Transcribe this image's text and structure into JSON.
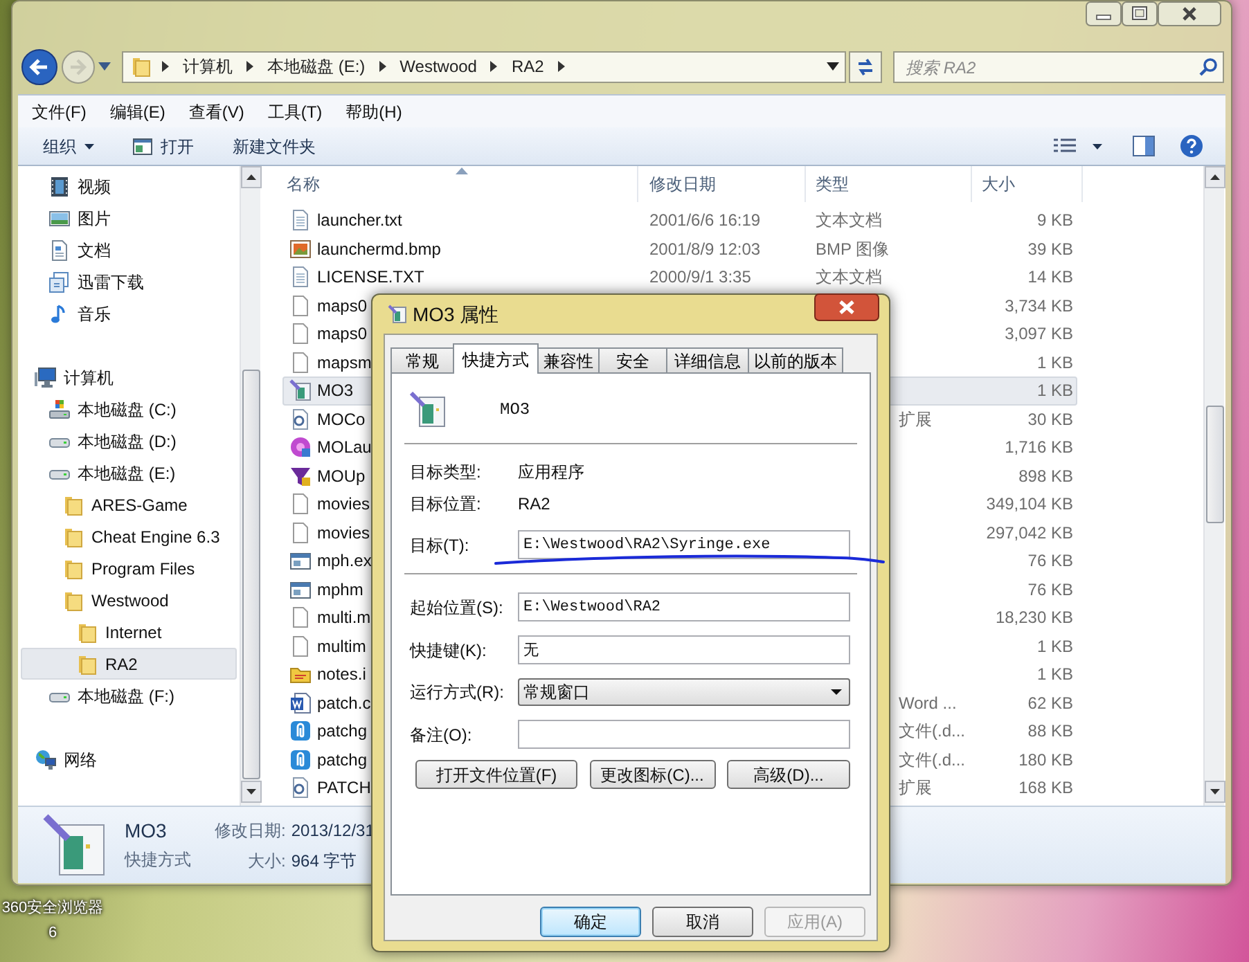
{
  "desktop_icon": {
    "label": "360安全浏览器6"
  },
  "explorer": {
    "breadcrumb": [
      "计算机",
      "本地磁盘 (E:)",
      "Westwood",
      "RA2"
    ],
    "search": {
      "placeholder": "搜索 RA2"
    },
    "menu": [
      "文件(F)",
      "编辑(E)",
      "查看(V)",
      "工具(T)",
      "帮助(H)"
    ],
    "toolbar": [
      {
        "label": "组织",
        "kind": "menu"
      },
      {
        "label": "打开",
        "kind": "open"
      },
      {
        "label": "新建文件夹",
        "kind": "plain"
      }
    ],
    "sidebar": [
      {
        "children": [
          {
            "label": "视频",
            "kind": "video",
            "selected": false
          },
          {
            "label": "图片",
            "kind": "pictures",
            "selected": false
          },
          {
            "label": "文档",
            "kind": "documents",
            "selected": false
          },
          {
            "label": "迅雷下载",
            "kind": "downloads",
            "selected": false
          },
          {
            "label": "音乐",
            "kind": "music",
            "selected": false
          }
        ]
      },
      {
        "label": "计算机",
        "kind": "computer",
        "selected": false,
        "children": [
          {
            "label": "本地磁盘 (C:)",
            "kind": "system-drive",
            "selected": false
          },
          {
            "label": "本地磁盘 (D:)",
            "kind": "drive",
            "selected": false
          },
          {
            "label": "本地磁盘 (E:)",
            "kind": "drive",
            "selected": false,
            "children": [
              {
                "label": "ARES-Game",
                "kind": "folder",
                "selected": false
              },
              {
                "label": "Cheat Engine 6.3",
                "kind": "folder",
                "selected": false
              },
              {
                "label": "Program Files",
                "kind": "folder",
                "selected": false
              },
              {
                "label": "Westwood",
                "kind": "folder",
                "selected": false,
                "children": [
                  {
                    "label": "Internet",
                    "kind": "folder",
                    "selected": false
                  },
                  {
                    "label": "RA2",
                    "kind": "folder",
                    "selected": true
                  }
                ]
              }
            ]
          },
          {
            "label": "本地磁盘 (F:)",
            "kind": "drive",
            "selected": false
          }
        ]
      },
      {
        "label": "网络",
        "kind": "network",
        "selected": false
      }
    ],
    "columns": [
      {
        "label": "名称",
        "sorted": true
      },
      {
        "label": "修改日期",
        "sorted": false
      },
      {
        "label": "类型",
        "sorted": false
      },
      {
        "label": "大小",
        "sorted": false
      }
    ],
    "rows": [
      {
        "name": "launcher.txt",
        "date": "2001/6/6 16:19",
        "type": "文本文档",
        "size": "9 KB",
        "kind": "text",
        "selected": false
      },
      {
        "name": "launchermd.bmp",
        "date": "2001/8/9 12:03",
        "type": "BMP 图像",
        "size": "39 KB",
        "kind": "image",
        "selected": false
      },
      {
        "name": "LICENSE.TXT",
        "date": "2000/9/1 3:35",
        "type": "文本文档",
        "size": "14 KB",
        "kind": "text",
        "selected": false
      },
      {
        "name": "maps0",
        "size": "3,734 KB",
        "kind": "file",
        "selected": false
      },
      {
        "name": "maps0",
        "size": "3,097 KB",
        "kind": "file",
        "selected": false
      },
      {
        "name": "mapsm",
        "size": "1 KB",
        "kind": "file",
        "selected": false
      },
      {
        "name": "MO3",
        "size": "1 KB",
        "kind": "shortcut",
        "selected": true
      },
      {
        "name": "MOCo",
        "type": "扩展",
        "size": "30 KB",
        "kind": "settings",
        "selected": false
      },
      {
        "name": "MOLau",
        "size": "1,716 KB",
        "kind": "flower",
        "selected": false
      },
      {
        "name": "MOUp",
        "size": "898 KB",
        "kind": "funnel",
        "selected": false
      },
      {
        "name": "movies",
        "size": "349,104 KB",
        "kind": "file",
        "selected": false
      },
      {
        "name": "movies",
        "size": "297,042 KB",
        "kind": "file",
        "selected": false
      },
      {
        "name": "mph.ex",
        "size": "76 KB",
        "kind": "window",
        "selected": false
      },
      {
        "name": "mphm",
        "size": "76 KB",
        "kind": "window",
        "selected": false
      },
      {
        "name": "multi.m",
        "size": "18,230 KB",
        "kind": "file",
        "selected": false
      },
      {
        "name": "multim",
        "size": "1 KB",
        "kind": "file",
        "selected": false
      },
      {
        "name": "notes.i",
        "size": "1 KB",
        "kind": "notes",
        "selected": false
      },
      {
        "name": "patch.c",
        "type": "Word ...",
        "size": "62 KB",
        "kind": "word",
        "selected": false
      },
      {
        "name": "patchg",
        "type": "文件(.d...",
        "size": "88 KB",
        "kind": "clip",
        "selected": false
      },
      {
        "name": "patchg",
        "type": "文件(.d...",
        "size": "180 KB",
        "kind": "clip",
        "selected": false
      },
      {
        "name": "PATCH",
        "type": "扩展",
        "size": "168 KB",
        "kind": "settings",
        "selected": false
      }
    ],
    "details": {
      "name": "MO3",
      "type": "快捷方式",
      "modified_label": "修改日期:",
      "modified": "2013/12/31",
      "size_label": "大小:",
      "size": "964 字节"
    }
  },
  "dialog": {
    "title": "MO3 属性",
    "tabs": [
      {
        "label": "常规",
        "selected": false
      },
      {
        "label": "快捷方式",
        "selected": true
      },
      {
        "label": "兼容性",
        "selected": false
      },
      {
        "label": "安全",
        "selected": false
      },
      {
        "label": "详细信息",
        "selected": false
      },
      {
        "label": "以前的版本",
        "selected": false
      }
    ],
    "name": "MO3",
    "info": [
      {
        "label": "目标类型:",
        "value": "应用程序"
      },
      {
        "label": "目标位置:",
        "value": "RA2"
      }
    ],
    "target": {
      "label": "目标(T):",
      "value": "E:\\Westwood\\RA2\\Syringe.exe"
    },
    "fields": [
      {
        "label": "起始位置(S):",
        "value": "E:\\Westwood\\RA2",
        "kind": "text"
      },
      {
        "label": "快捷键(K):",
        "value": "无",
        "kind": "text"
      },
      {
        "label": "运行方式(R):",
        "value": "常规窗口",
        "kind": "select"
      },
      {
        "label": "备注(O):",
        "kind": "text"
      }
    ],
    "actions": [
      "打开文件位置(F)",
      "更改图标(C)...",
      "高级(D)..."
    ],
    "buttons": [
      {
        "label": "确定",
        "default": true,
        "disabled": false
      },
      {
        "label": "取消",
        "default": false,
        "disabled": false
      },
      {
        "label": "应用(A)",
        "default": false,
        "disabled": true
      }
    ]
  }
}
